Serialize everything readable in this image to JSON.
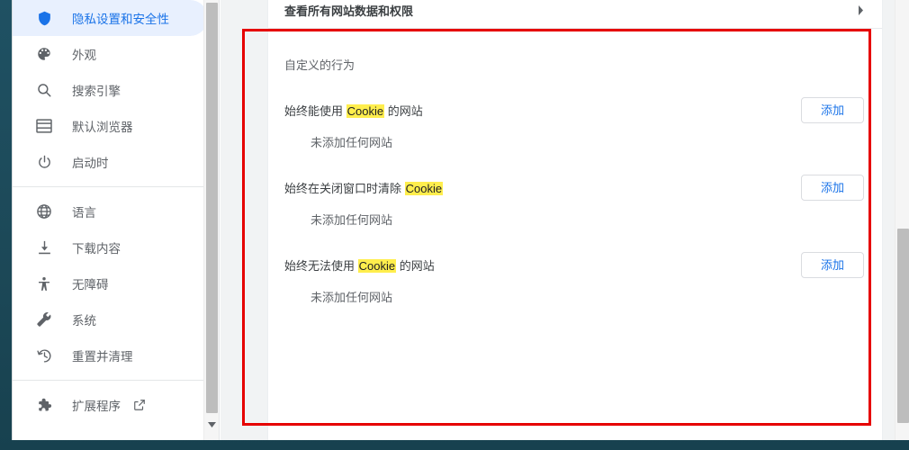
{
  "window": {
    "accent_blue": "#1a73e8",
    "selected_bg": "#e8f0fe",
    "highlight_yellow": "#ffee4d",
    "annotation_color": "#e60000",
    "desktop_bg": "#1d4e5e"
  },
  "sidebar": {
    "groups": [
      {
        "items": [
          {
            "label": "隐私设置和安全性",
            "icon": "shield-icon",
            "selected": true
          },
          {
            "label": "外观",
            "icon": "palette-icon",
            "selected": false
          },
          {
            "label": "搜索引擎",
            "icon": "search-icon",
            "selected": false
          },
          {
            "label": "默认浏览器",
            "icon": "browser-window-icon",
            "selected": false
          },
          {
            "label": "启动时",
            "icon": "power-icon",
            "selected": false
          }
        ]
      },
      {
        "items": [
          {
            "label": "语言",
            "icon": "globe-icon",
            "selected": false
          },
          {
            "label": "下载内容",
            "icon": "download-icon",
            "selected": false
          },
          {
            "label": "无障碍",
            "icon": "accessibility-icon",
            "selected": false
          },
          {
            "label": "系统",
            "icon": "wrench-icon",
            "selected": false
          },
          {
            "label": "重置并清理",
            "icon": "history-restore-icon",
            "selected": false
          }
        ]
      },
      {
        "items": [
          {
            "label": "扩展程序",
            "icon": "puzzle-icon",
            "selected": false,
            "external": true
          }
        ]
      }
    ]
  },
  "content": {
    "top_row": {
      "title": "查看所有网站数据和权限",
      "chevron": "chevron-right-icon"
    },
    "section_label": "自定义的行为",
    "prefs": [
      {
        "title_before": "始终能使用 ",
        "title_highlight": "Cookie",
        "title_after": " 的网站",
        "button": "添加",
        "empty": "未添加任何网站"
      },
      {
        "title_before": "始终在关闭窗口时清除 ",
        "title_highlight": "Cookie",
        "title_after": "",
        "button": "添加",
        "empty": "未添加任何网站"
      },
      {
        "title_before": "始终无法使用 ",
        "title_highlight": "Cookie",
        "title_after": " 的网站",
        "button": "添加",
        "empty": "未添加任何网站"
      }
    ]
  }
}
